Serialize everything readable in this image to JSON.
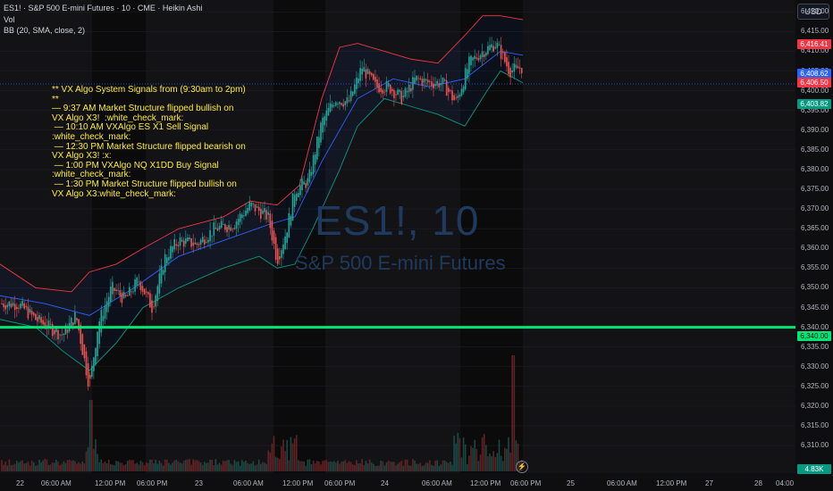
{
  "header": {
    "symbol_line": "ES1! · S&P 500 E-mini Futures · 10 · CME · Heikin Ashi",
    "vol_label": "Vol",
    "indicator_line": "BB (20, SMA, close, 2)",
    "currency": "USD"
  },
  "watermark": {
    "symbol": "ES1!, 10",
    "name": "S&P 500 E-mini Futures"
  },
  "note_lines": [
    "** VX Algo System Signals from (9:30am to 2pm)",
    "**",
    "— 9:37 AM Market Structure flipped bullish on",
    "VX Algo X3!  :white_check_mark:",
    " — 10:10 AM VXAlgo ES X1 Sell Signal",
    ":white_check_mark:",
    " — 12:30 PM Market Structure flipped bearish on",
    "VX Algo X3! :x:",
    " — 1:00 PM VXAlgo NQ X1DD Buy Signal",
    ":white_check_mark:",
    " — 1:30 PM Market Structure flipped bullish on",
    "VX Algo X3:white_check_mark:"
  ],
  "price_tags": {
    "bb_upper": "6,416.41",
    "mid_a": "6,408.62",
    "last_price": "6,406.50",
    "bb_lower": "6,403.82",
    "level_line": "6,340.00",
    "volume": "4.83K"
  },
  "colors": {
    "up": "#26a69a",
    "down": "#ef5350",
    "bb_upper": "#f23645",
    "bb_basis": "#2962ff",
    "bb_lower": "#089981",
    "level_line": "#00e676",
    "text_yellow": "#ffeb3b"
  },
  "replay_icon": "⚡",
  "chart_data": {
    "type": "candlestick",
    "style": "Heikin Ashi",
    "interval": "10",
    "ylim": [
      6303,
      6423
    ],
    "y_ticks": [
      6310,
      6315,
      6320,
      6325,
      6330,
      6335,
      6340,
      6345,
      6350,
      6355,
      6360,
      6365,
      6370,
      6375,
      6380,
      6385,
      6390,
      6395,
      6400,
      6405,
      6410,
      6415,
      6420
    ],
    "y_tick_labels": [
      "6,310.00",
      "6,315.00",
      "6,320.00",
      "6,325.00",
      "6,330.00",
      "6,335.00",
      "6,340.00",
      "6,345.00",
      "6,350.00",
      "6,355.00",
      "6,360.00",
      "6,365.00",
      "6,370.00",
      "6,375.00",
      "6,380.00",
      "6,385.00",
      "6,390.00",
      "6,395.00",
      "6,400.00",
      "6,405.00",
      "6,410.00",
      "6,415.00",
      "6,420.00"
    ],
    "x_tick_labels": [
      "22",
      "06:00 AM",
      "12:00 PM",
      "06:00 PM",
      "23",
      "06:00 AM",
      "12:00 PM",
      "06:00 PM",
      "24",
      "06:00 AM",
      "12:00 PM",
      "06:00 PM",
      "25",
      "06:00 AM",
      "12:00 PM",
      "27",
      "28",
      "04:00"
    ],
    "horizontal_line": 6340,
    "close_path": [
      [
        0,
        6346
      ],
      [
        20,
        6346
      ],
      [
        40,
        6342
      ],
      [
        55,
        6340
      ],
      [
        70,
        6338
      ],
      [
        85,
        6343
      ],
      [
        100,
        6325
      ],
      [
        110,
        6341
      ],
      [
        125,
        6350
      ],
      [
        140,
        6347
      ],
      [
        155,
        6352
      ],
      [
        170,
        6345
      ],
      [
        185,
        6358
      ],
      [
        200,
        6362
      ],
      [
        220,
        6361
      ],
      [
        240,
        6365
      ],
      [
        260,
        6366
      ],
      [
        280,
        6371
      ],
      [
        300,
        6368
      ],
      [
        310,
        6357
      ],
      [
        320,
        6364
      ],
      [
        330,
        6375
      ],
      [
        345,
        6377
      ],
      [
        360,
        6392
      ],
      [
        375,
        6398
      ],
      [
        390,
        6397
      ],
      [
        405,
        6406
      ],
      [
        420,
        6401
      ],
      [
        435,
        6401
      ],
      [
        450,
        6398
      ],
      [
        465,
        6403
      ],
      [
        480,
        6402
      ],
      [
        495,
        6402
      ],
      [
        510,
        6397
      ],
      [
        525,
        6407
      ],
      [
        540,
        6410
      ],
      [
        555,
        6412
      ],
      [
        570,
        6405
      ],
      [
        585,
        6406
      ]
    ],
    "series": [
      {
        "name": "Basis",
        "values": [
          [
            0,
            6348
          ],
          [
            50,
            6346
          ],
          [
            100,
            6343
          ],
          [
            150,
            6350
          ],
          [
            200,
            6358
          ],
          [
            250,
            6362
          ],
          [
            300,
            6366
          ],
          [
            330,
            6368
          ],
          [
            360,
            6382
          ],
          [
            400,
            6398
          ],
          [
            440,
            6403
          ],
          [
            480,
            6401
          ],
          [
            520,
            6403
          ],
          [
            560,
            6410
          ],
          [
            585,
            6409
          ]
        ]
      },
      {
        "name": "Upper",
        "values": [
          [
            0,
            6356
          ],
          [
            40,
            6350
          ],
          [
            80,
            6349
          ],
          [
            100,
            6354
          ],
          [
            130,
            6356
          ],
          [
            160,
            6360
          ],
          [
            200,
            6365
          ],
          [
            250,
            6368
          ],
          [
            280,
            6372
          ],
          [
            310,
            6371
          ],
          [
            335,
            6376
          ],
          [
            360,
            6398
          ],
          [
            380,
            6411
          ],
          [
            400,
            6412
          ],
          [
            430,
            6410
          ],
          [
            460,
            6408
          ],
          [
            490,
            6407
          ],
          [
            520,
            6414
          ],
          [
            540,
            6419
          ],
          [
            560,
            6419
          ],
          [
            585,
            6418
          ]
        ]
      },
      {
        "name": "Lower",
        "values": [
          [
            0,
            6342
          ],
          [
            40,
            6340
          ],
          [
            70,
            6334
          ],
          [
            100,
            6329
          ],
          [
            130,
            6336
          ],
          [
            160,
            6345
          ],
          [
            200,
            6350
          ],
          [
            250,
            6355
          ],
          [
            290,
            6358
          ],
          [
            310,
            6355
          ],
          [
            330,
            6356
          ],
          [
            350,
            6365
          ],
          [
            380,
            6380
          ],
          [
            400,
            6391
          ],
          [
            430,
            6398
          ],
          [
            460,
            6396
          ],
          [
            490,
            6394
          ],
          [
            520,
            6391
          ],
          [
            545,
            6400
          ],
          [
            560,
            6405
          ],
          [
            585,
            6402
          ]
        ]
      }
    ]
  }
}
